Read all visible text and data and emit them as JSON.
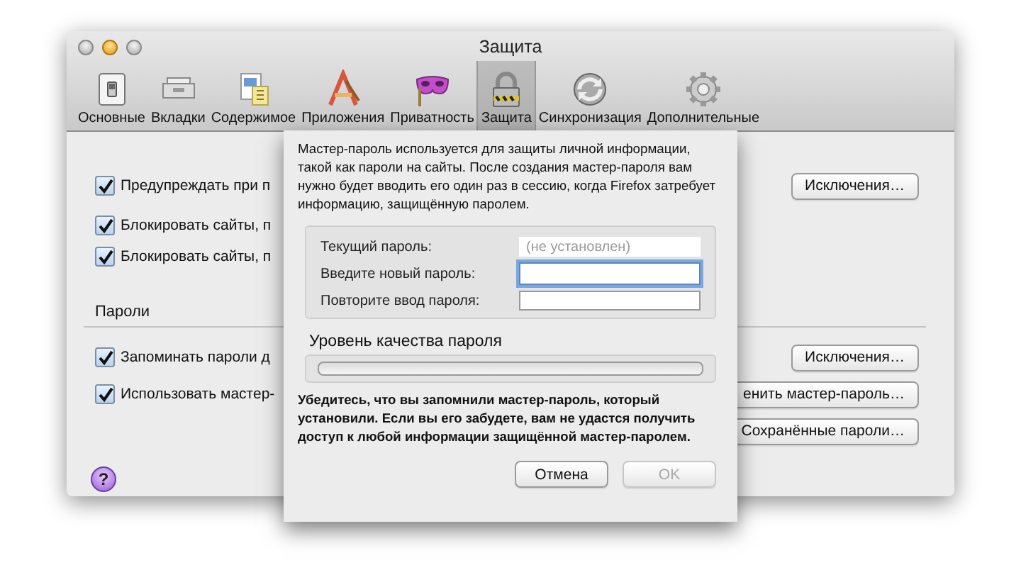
{
  "window": {
    "title": "Защита"
  },
  "toolbar": [
    {
      "label": "Основные",
      "selected": false
    },
    {
      "label": "Вкладки",
      "selected": false
    },
    {
      "label": "Содержимое",
      "selected": false
    },
    {
      "label": "Приложения",
      "selected": false
    },
    {
      "label": "Приватность",
      "selected": false
    },
    {
      "label": "Защита",
      "selected": true
    },
    {
      "label": "Синхронизация",
      "selected": false
    },
    {
      "label": "Дополнительные",
      "selected": false
    }
  ],
  "security": {
    "checkboxes": [
      {
        "label": "Предупреждать при п",
        "checked": true
      },
      {
        "label": "Блокировать сайты, п",
        "checked": true
      },
      {
        "label": "Блокировать сайты, п",
        "checked": true
      }
    ],
    "buttons": [
      "Исключения…"
    ]
  },
  "passwords": {
    "heading": "Пароли",
    "checkboxes": [
      {
        "label": "Запоминать пароли д",
        "checked": true
      },
      {
        "label": "Использовать мастер-",
        "checked": true
      }
    ],
    "buttons": [
      "Исключения…",
      "енить мастер-пароль…",
      "Сохранённые пароли…"
    ]
  },
  "help": "?",
  "dialog": {
    "intro": "Мастер-пароль используется для защиты личной информации, такой как пароли на сайты. После создания мастер-пароля вам нужно будет вводить его один раз в сессию, когда Firefox затребует информацию, защищённую паролем.",
    "fields": [
      {
        "label": "Текущий пароль:",
        "placeholder": "(не установлен)",
        "disabled": true,
        "focused": false
      },
      {
        "label": "Введите новый пароль:",
        "disabled": false,
        "focused": true
      },
      {
        "label": "Повторите ввод пароля:",
        "disabled": false,
        "focused": false
      }
    ],
    "quality": {
      "label": "Уровень качества пароля",
      "level": 0
    },
    "warning": "Убедитесь, что вы запомнили мастер-пароль, который установили. Если вы его забудете, вам не удастся получить доступ к любой информации защищённой мастер-паролем.",
    "buttons": [
      {
        "label": "Отмена",
        "disabled": false
      },
      {
        "label": "OK",
        "disabled": true
      }
    ]
  }
}
